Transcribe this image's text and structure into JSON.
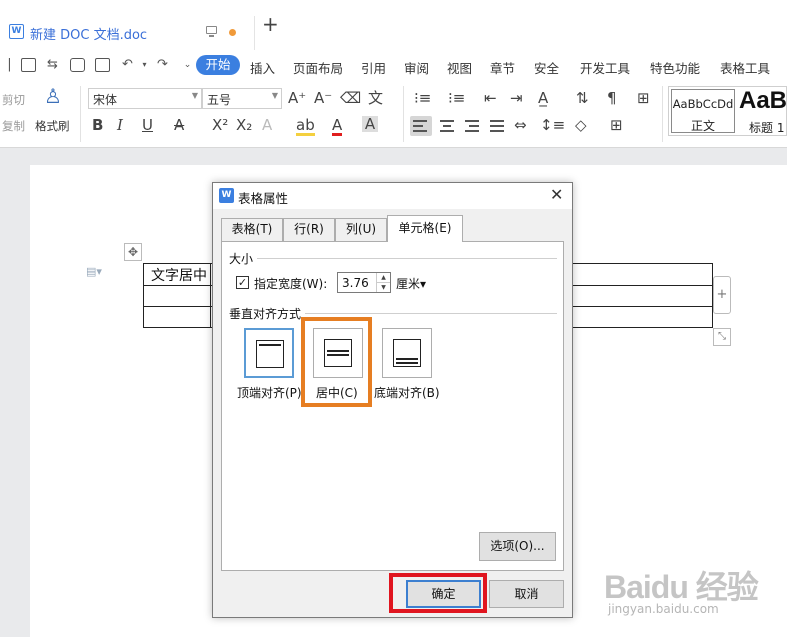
{
  "titlebar": {
    "doc_name": "新建 DOC 文档.doc",
    "doc_icon": "W",
    "new_tab": "+"
  },
  "menu": {
    "start": "开始",
    "items": [
      "插入",
      "页面布局",
      "引用",
      "审阅",
      "视图",
      "章节",
      "安全",
      "开发工具",
      "特色功能",
      "表格工具"
    ]
  },
  "ribbon": {
    "cut": "剪切",
    "copy": "复制",
    "format_painter": "格式刷",
    "font": "宋体",
    "size": "五号",
    "style_normal_sample": "AaBbCcDd",
    "style_normal_name": "正文",
    "style_h1_sample": "AaBl",
    "style_h1_name": "标题 1"
  },
  "document": {
    "cell_text": "文字居中",
    "add_button": "+"
  },
  "dialog": {
    "title": "表格属性",
    "tabs": [
      "表格(T)",
      "行(R)",
      "列(U)",
      "单元格(E)"
    ],
    "active_tab": "单元格(E)",
    "size_group": "大小",
    "width_checkbox_label": "指定宽度(W):",
    "width_checked": true,
    "width_value": "3.76",
    "width_unit": "厘米▾",
    "valign_group": "垂直对齐方式",
    "align_top": "顶端对齐(P)",
    "align_center": "居中(C)",
    "align_bottom": "底端对齐(B)",
    "options_button": "选项(O)...",
    "ok_button": "确定",
    "cancel_button": "取消"
  },
  "annotations": {
    "center_highlight_color": "#e67e22",
    "ok_highlight_color": "#e0151f"
  },
  "watermark": {
    "brand": "Baidu 经验",
    "url": "jingyan.baidu.com"
  },
  "colors": {
    "accent": "#3b7fe0",
    "unsaved_dot": "#f09a3a"
  }
}
